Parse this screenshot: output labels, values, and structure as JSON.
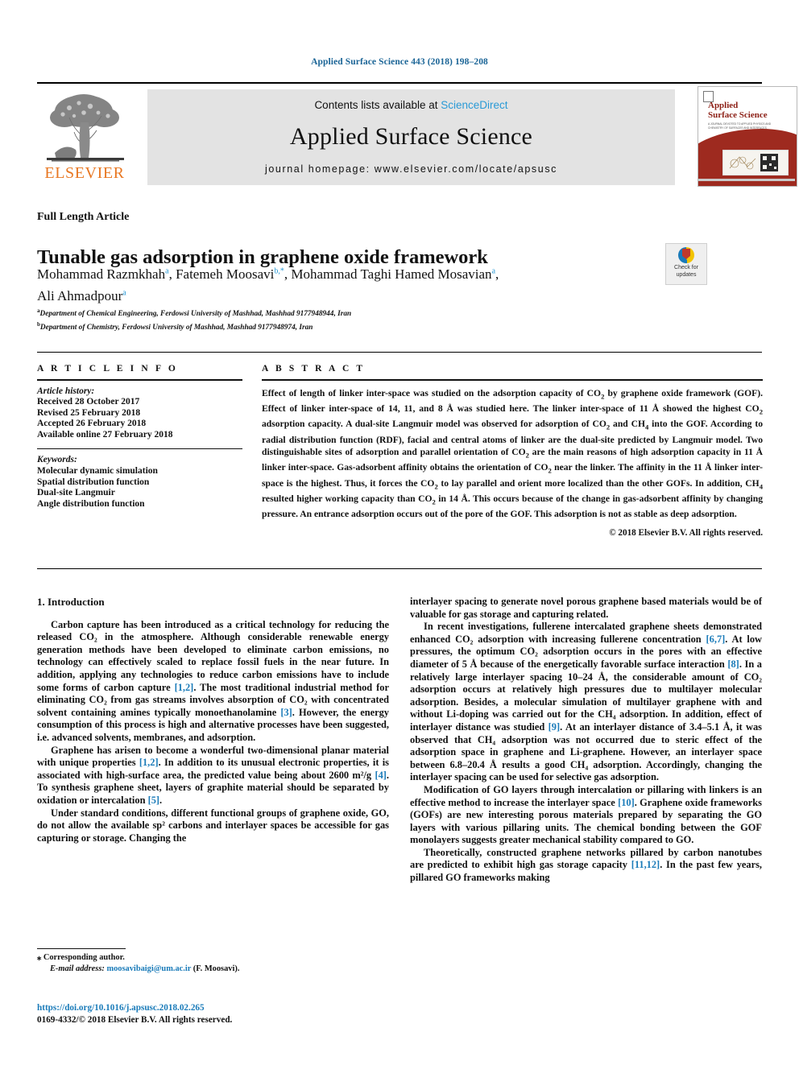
{
  "running_head": "Applied Surface Science 443 (2018) 198–208",
  "masthead": {
    "contents_prefix": "Contents lists available at ",
    "sciencedirect": "ScienceDirect",
    "journal_title": "Applied Surface Science",
    "homepage": "journal homepage: www.elsevier.com/locate/apsusc",
    "publisher": "ELSEVIER",
    "cover_title_line1": "Applied",
    "cover_title_line2": "Surface Science",
    "cover_subtitle": "A JOURNAL DEVOTED TO APPLIED PHYSICS AND CHEMISTRY OF SURFACES AND INTERFACES"
  },
  "article": {
    "type": "Full Length Article",
    "title": "Tunable gas adsorption in graphene oxide framework",
    "authors_line1": "Mohammad Razmkhah",
    "authors_line1_sup": "a",
    "authors": [
      {
        "name": "Mohammad Razmkhah",
        "sup": "a",
        "sep": ", "
      },
      {
        "name": "Fatemeh Moosavi",
        "sup": "b,*",
        "sep": ", "
      },
      {
        "name": "Mohammad Taghi Hamed Mosavian",
        "sup": "a",
        "sep": ", "
      },
      {
        "name": "Ali Ahmadpour",
        "sup": "a",
        "sep": ""
      }
    ],
    "affiliations": [
      {
        "sup": "a",
        "text": "Department of Chemical Engineering, Ferdowsi University of Mashhad, Mashhad 9177948944, Iran"
      },
      {
        "sup": "b",
        "text": "Department of Chemistry, Ferdowsi University of Mashhad, Mashhad 9177948974, Iran"
      }
    ],
    "crossmark_line1": "Check for",
    "crossmark_line2": "updates"
  },
  "article_info": {
    "heading": "A R T I C L E   I N F O",
    "history_label": "Article history:",
    "history": [
      "Received 28 October 2017",
      "Revised 25 February 2018",
      "Accepted 26 February 2018",
      "Available online 27 February 2018"
    ],
    "keywords_label": "Keywords:",
    "keywords": [
      "Molecular dynamic simulation",
      "Spatial distribution function",
      "Dual-site Langmuir",
      "Angle distribution function"
    ]
  },
  "abstract": {
    "heading": "A B S T R A C T",
    "text_parts": [
      "Effect of length of linker inter-space was studied on the adsorption capacity of CO",
      "2",
      " by graphene oxide framework (GOF). Effect of linker inter-space of 14, 11, and 8 Å was studied here. The linker inter-space of 11 Å showed the highest CO",
      "2",
      " adsorption capacity. A dual-site Langmuir model was observed for adsorption of CO",
      "2",
      " and CH",
      "4",
      " into the GOF. According to radial distribution function (RDF), facial and central atoms of linker are the dual-site predicted by Langmuir model. Two distinguishable sites of adsorption and parallel orientation of CO",
      "2",
      " are the main reasons of high adsorption capacity in 11 Å linker inter-space. Gas-adsorbent affinity obtains the orientation of CO",
      "2",
      " near the linker. The affinity in the 11 Å linker inter-space is the highest. Thus, it forces the CO",
      "2",
      " to lay parallel and orient more localized than the other GOFs. In addition, CH",
      "4",
      " resulted higher working capacity than CO",
      "2",
      " in 14 Å. This occurs because of the change in gas-adsorbent affinity by changing pressure. An entrance adsorption occurs out of the pore of the GOF. This adsorption is not as stable as deep adsorption."
    ],
    "copyright": "© 2018 Elsevier B.V. All rights reserved."
  },
  "body": {
    "section_heading": "1. Introduction",
    "left_paragraphs": [
      "Carbon capture has been introduced as a critical technology for reducing the released CO₂ in the atmosphere. Although considerable renewable energy generation methods have been developed to eliminate carbon emissions, no technology can effectively scaled to replace fossil fuels in the near future. In addition, applying any technologies to reduce carbon emissions have to include some forms of carbon capture [1,2]. The most traditional industrial method for eliminating CO₂ from gas streams involves absorption of CO₂ with concentrated solvent containing amines typically monoethanolamine [3]. However, the energy consumption of this process is high and alternative processes have been suggested, i.e. advanced solvents, membranes, and adsorption.",
      "Graphene has arisen to become a wonderful two-dimensional planar material with unique properties [1,2]. In addition to its unusual electronic properties, it is associated with high-surface area, the predicted value being about 2600 m²/g [4]. To synthesis graphene sheet, layers of graphite material should be separated by oxidation or intercalation [5].",
      "Under standard conditions, different functional groups of graphene oxide, GO, do not allow the available sp² carbons and interlayer spaces be accessible for gas capturing or storage. Changing the"
    ],
    "right_paragraphs": [
      "interlayer spacing to generate novel porous graphene based materials would be of valuable for gas storage and capturing related.",
      "In recent investigations, fullerene intercalated graphene sheets demonstrated enhanced CO₂ adsorption with increasing fullerene concentration [6,7]. At low pressures, the optimum CO₂ adsorption occurs in the pores with an effective diameter of 5 Å because of the energetically favorable surface interaction [8]. In a relatively large interlayer spacing 10–24 Å, the considerable amount of CO₂ adsorption occurs at relatively high pressures due to multilayer molecular adsorption. Besides, a molecular simulation of multilayer graphene with and without Li-doping was carried out for the CH₄ adsorption. In addition, effect of interlayer distance was studied [9]. At an interlayer distance of 3.4–5.1 Å, it was observed that CH₄ adsorption was not occurred due to steric effect of the adsorption space in graphene and Li-graphene. However, an interlayer space between 6.8–20.4 Å results a good CH₄ adsorption. Accordingly, changing the interlayer spacing can be used for selective gas adsorption.",
      "Modification of GO layers through intercalation or pillaring with linkers is an effective method to increase the interlayer space [10]. Graphene oxide frameworks (GOFs) are new interesting porous materials prepared by separating the GO layers with various pillaring units. The chemical bonding between the GOF monolayers suggests greater mechanical stability compared to GO.",
      "Theoretically, constructed graphene networks pillared by carbon nanotubes are predicted to exhibit high gas storage capacity [11,12]. In the past few years, pillared GO frameworks making"
    ]
  },
  "footer": {
    "corresponding_marker": "⁎",
    "corresponding_text": "Corresponding author.",
    "email_label": "E-mail address:",
    "email": "moosavibaigi@um.ac.ir",
    "email_owner": "(F. Moosavi).",
    "doi": "https://doi.org/10.1016/j.apsusc.2018.02.265",
    "issn_line": "0169-4332/© 2018 Elsevier B.V. All rights reserved."
  },
  "colors": {
    "link": "#1a7bb9",
    "running_head": "#1a6496",
    "sciencedirect": "#2a9ad6",
    "elsevier_orange": "#E87722",
    "banner_bg": "#e3e3e3",
    "cover_red": "#9e2a1f"
  }
}
